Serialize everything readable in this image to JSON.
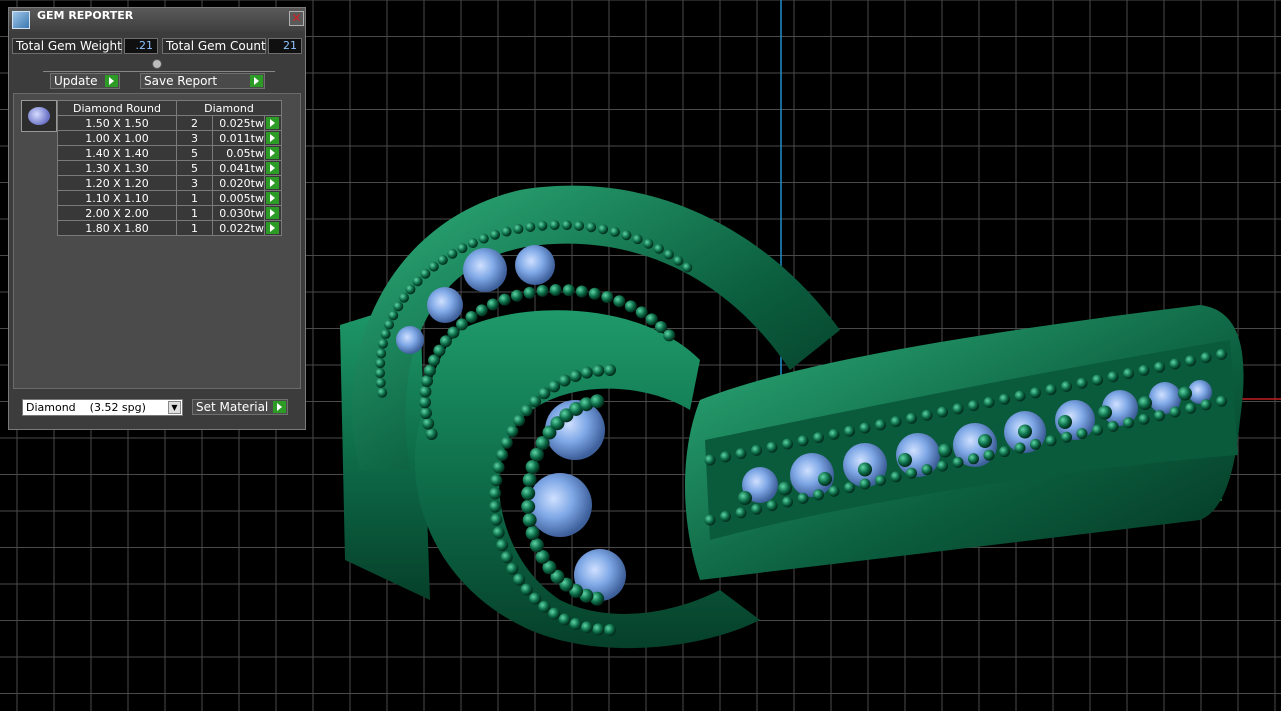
{
  "panel": {
    "title": "GEM REPORTER",
    "close_symbol": "✕",
    "total_weight_label": "Total Gem Weight",
    "total_weight_value": ".21",
    "total_count_label": "Total Gem Count",
    "total_count_value": "21",
    "update_label": "Update",
    "save_report_label": "Save Report",
    "table": {
      "header_shape": "Diamond Round",
      "header_material": "Diamond",
      "rows": [
        {
          "size": "1.50 X 1.50",
          "count": "2",
          "weight": "0.025tw"
        },
        {
          "size": "1.00 X 1.00",
          "count": "3",
          "weight": "0.011tw"
        },
        {
          "size": "1.40 X 1.40",
          "count": "5",
          "weight": "0.05tw"
        },
        {
          "size": "1.30 X 1.30",
          "count": "5",
          "weight": "0.041tw"
        },
        {
          "size": "1.20 X 1.20",
          "count": "3",
          "weight": "0.020tw"
        },
        {
          "size": "1.10 X 1.10",
          "count": "1",
          "weight": "0.005tw"
        },
        {
          "size": "2.00 X 2.00",
          "count": "1",
          "weight": "0.030tw"
        },
        {
          "size": "1.80 X 1.80",
          "count": "1",
          "weight": "0.022tw"
        }
      ]
    },
    "material_value": "Diamond    (3.52 spg)",
    "set_material_label": "Set Material"
  },
  "colors": {
    "metal": "#0e6e4a",
    "gem": "#6f9fe0",
    "grid": "#5a5a5a",
    "axis_cyan": "#1e90c8",
    "axis_red": "#c02020"
  }
}
